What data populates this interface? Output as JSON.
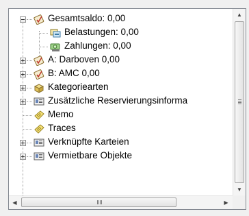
{
  "tree": {
    "items": [
      {
        "label": "Gesamtsaldo: 0,00",
        "icon": "ledger-check-icon",
        "state": "expanded"
      },
      {
        "label": "Belastungen: 0,00",
        "icon": "charges-icon"
      },
      {
        "label": "Zahlungen: 0,00",
        "icon": "payments-icon"
      },
      {
        "label": "A: Darboven 0,00",
        "icon": "ledger-check-icon",
        "state": "collapsed"
      },
      {
        "label": "B: AMC  0,00",
        "icon": "ledger-check-icon",
        "state": "collapsed"
      },
      {
        "label": "Kategoriearten",
        "icon": "category-box-icon",
        "state": "collapsed"
      },
      {
        "label": "Zusätzliche Reservierungsinforma",
        "icon": "info-card-icon",
        "state": "collapsed"
      },
      {
        "label": "Memo",
        "icon": "memo-note-icon"
      },
      {
        "label": "Traces",
        "icon": "memo-note-icon"
      },
      {
        "label": "Verknüpfte Karteien",
        "icon": "info-card-icon",
        "state": "collapsed"
      },
      {
        "label": "Vermietbare Objekte",
        "icon": "info-card-icon",
        "state": "collapsed"
      }
    ]
  },
  "scrollbars": {
    "vertical": {
      "up_glyph": "▲",
      "down_glyph": "▼",
      "grip_glyph": "≡"
    },
    "horizontal": {
      "left_glyph": "◀",
      "right_glyph": "▶",
      "grip_glyph": "|||"
    }
  }
}
